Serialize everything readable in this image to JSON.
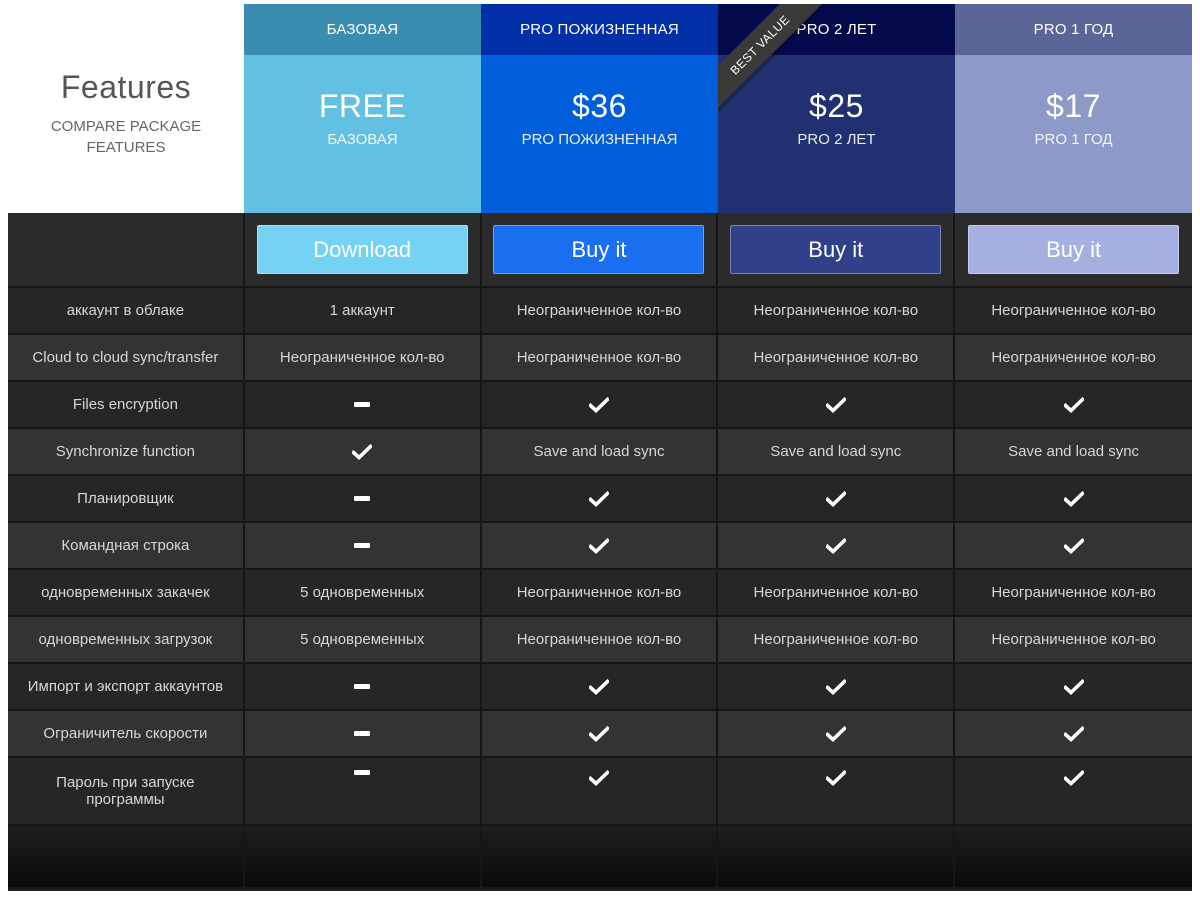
{
  "features_header": {
    "title": "Features",
    "subtitle": "COMPARE PACKAGE FEATURES"
  },
  "plans": [
    {
      "name": "БАЗОВАЯ",
      "price": "FREE",
      "sub": "БАЗОВАЯ",
      "button": "Download",
      "colors": {
        "header": "#3a8db1",
        "body": "#62c1e2",
        "button": "#74d2f2"
      }
    },
    {
      "name": "PRO ПОЖИЗНЕННАЯ",
      "price": "$36",
      "sub": "PRO ПОЖИЗНЕННАЯ",
      "button": "Buy it",
      "colors": {
        "header": "#002fa8",
        "body": "#005ddc",
        "button": "#1a6ff0"
      }
    },
    {
      "name": "PRO 2 ЛЕТ",
      "price": "$25",
      "sub": "PRO 2 ЛЕТ",
      "button": "Buy it",
      "ribbon": "BEST VALUE",
      "colors": {
        "header": "#050a4c",
        "body": "#203070",
        "button": "#314189"
      }
    },
    {
      "name": "PRO 1 ГОД",
      "price": "$17",
      "sub": "PRO 1 ГОД",
      "button": "Buy it",
      "colors": {
        "header": "#5a6698",
        "body": "#8c99c9",
        "button": "#a6b0e0"
      }
    }
  ],
  "rows": [
    {
      "name": "аккаунт в облаке",
      "values": [
        "1 аккаунт",
        "Неограниченное кол-во",
        "Неограниченное кол-во",
        "Неограниченное кол-во"
      ]
    },
    {
      "name": "Cloud to cloud  sync/transfer",
      "values": [
        "Неограниченное кол-во",
        "Неограниченное кол-во",
        "Неограниченное кол-во",
        "Неограниченное кол-во"
      ]
    },
    {
      "name": "Files encryption",
      "values": [
        "dash",
        "check",
        "check",
        "check"
      ]
    },
    {
      "name": "Synchronize function",
      "values": [
        "check",
        "Save and load sync",
        "Save and load sync",
        "Save and load sync"
      ]
    },
    {
      "name": "Планировщик",
      "values": [
        "dash",
        "check",
        "check",
        "check"
      ]
    },
    {
      "name": "Командная строка",
      "values": [
        "dash",
        "check",
        "check",
        "check"
      ]
    },
    {
      "name": "одновременных закачек",
      "values": [
        "5 одновременных",
        "Неограниченное кол-во",
        "Неограниченное кол-во",
        "Неограниченное кол-во"
      ]
    },
    {
      "name": "одновременных загрузок",
      "values": [
        "5 одновременных",
        "Неограниченное кол-во",
        "Неограниченное кол-во",
        "Неограниченное кол-во"
      ]
    },
    {
      "name": "Импорт и экспорт аккаунтов",
      "values": [
        "dash",
        "check",
        "check",
        "check"
      ]
    },
    {
      "name": "Ограничитель скорости",
      "values": [
        "dash",
        "check",
        "check",
        "check"
      ]
    },
    {
      "name": "Пароль при запуске программы",
      "values": [
        "dash",
        "check",
        "check",
        "check"
      ]
    }
  ]
}
